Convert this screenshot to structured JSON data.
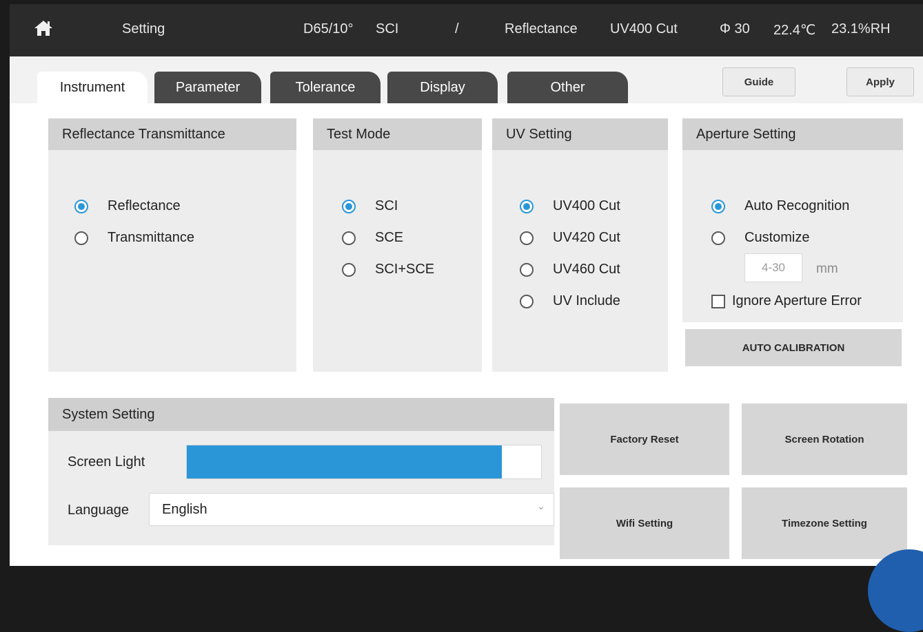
{
  "topbar": {
    "title": "Setting",
    "illuminant": "D65/10°",
    "mode": "SCI",
    "separator": "/",
    "measure": "Reflectance",
    "uv": "UV400 Cut",
    "aperture": "Φ 30",
    "temperature": "22.4℃",
    "humidity": "23.1%RH",
    "home_icon": "home-icon"
  },
  "tabs": [
    {
      "label": "Instrument",
      "active": true
    },
    {
      "label": "Parameter",
      "active": false
    },
    {
      "label": "Tolerance",
      "active": false
    },
    {
      "label": "Display",
      "active": false
    },
    {
      "label": "Other",
      "active": false
    }
  ],
  "buttons": {
    "guide": "Guide",
    "apply": "Apply"
  },
  "panels": {
    "reflectance_transmittance": {
      "title": "Reflectance Transmittance",
      "options": [
        "Reflectance",
        "Transmittance"
      ],
      "selected": "Reflectance"
    },
    "test_mode": {
      "title": "Test Mode",
      "options": [
        "SCI",
        "SCE",
        "SCI+SCE"
      ],
      "selected": "SCI"
    },
    "uv_setting": {
      "title": "UV Setting",
      "options": [
        "UV400 Cut",
        "UV420 Cut",
        "UV460 Cut",
        "UV Include"
      ],
      "selected": "UV400 Cut"
    },
    "aperture_setting": {
      "title": "Aperture Setting",
      "options": [
        "Auto Recognition",
        "Customize"
      ],
      "selected": "Auto Recognition",
      "range_placeholder": "4-30",
      "unit": "mm",
      "ignore_error_label": "Ignore Aperture Error",
      "ignore_error_checked": false,
      "auto_calibration": "AUTO CALIBRATION"
    }
  },
  "system": {
    "title": "System Setting",
    "screen_light_label": "Screen Light",
    "screen_light_level": 0.89,
    "language_label": "Language",
    "language_value": "English",
    "buttons": {
      "factory_reset": "Factory Reset",
      "screen_rotation": "Screen Rotation",
      "wifi_setting": "Wifi Setting",
      "timezone_setting": "Timezone Setting"
    }
  },
  "colors": {
    "accent": "#2a96d8",
    "topbar": "#2b2b2b",
    "tab_inactive": "#484848"
  }
}
